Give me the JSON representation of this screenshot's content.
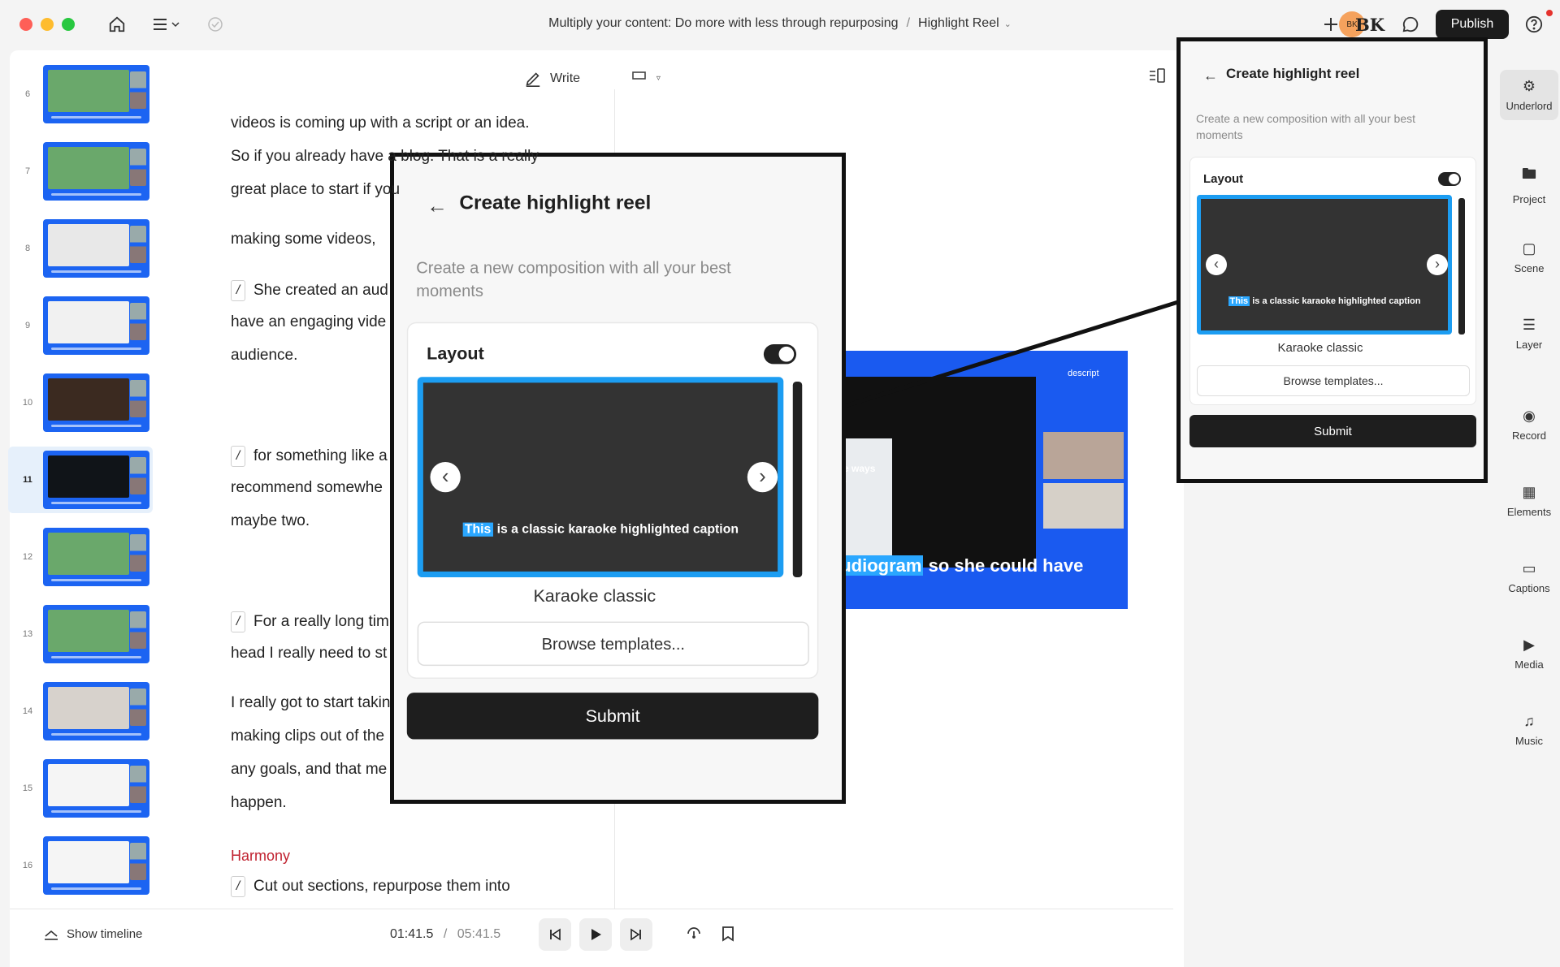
{
  "app": {
    "breadcrumb_project": "Multiply your content: Do more with less through repurposing",
    "breadcrumb_sep": "/",
    "breadcrumb_comp": "Highlight Reel",
    "avatar_initials": "BK",
    "avatar_small": "BK",
    "publish_label": "Publish"
  },
  "editor": {
    "write_label": "Write",
    "scenes": [
      {
        "num": "6"
      },
      {
        "num": "7"
      },
      {
        "num": "8"
      },
      {
        "num": "9"
      },
      {
        "num": "10"
      },
      {
        "num": "11"
      },
      {
        "num": "12"
      },
      {
        "num": "13"
      },
      {
        "num": "14"
      },
      {
        "num": "15"
      },
      {
        "num": "16"
      }
    ],
    "script_lines": [
      "videos is coming up with a script or an idea.",
      "So if you already have a blog. That is a really",
      "great place to start if you",
      "making some videos,",
      "She created an aud",
      "have an engaging vide",
      "audience.",
      "for something like a",
      "recommend somewhe",
      "maybe two.",
      "For a really long tim",
      "head I really need to st",
      "I really got to start takin",
      "making clips out of the",
      "any goals, and that me",
      "happen.",
      "Cut out sections, repurpose them into"
    ],
    "speaker": "Harmony"
  },
  "preview": {
    "caption_highlight": "audiogram",
    "caption_rest": "so she could have",
    "logo": "descript",
    "side_text": "five ways hts"
  },
  "playback": {
    "show_timeline": "Show timeline",
    "current_time": "01:41.5",
    "separator": "/",
    "total_time": "05:41.5"
  },
  "highlight_panel": {
    "title": "Create highlight reel",
    "description": "Create a new composition with all your best moments",
    "layout_label": "Layout",
    "layout_toggle_on": true,
    "caption_highlight": "This",
    "caption_rest": " is a classic karaoke highlighted caption",
    "template_name": "Karaoke classic",
    "browse_label": "Browse templates...",
    "submit_label": "Submit"
  },
  "rail": {
    "items": [
      {
        "label": "Underlord",
        "icon": "robot-icon"
      },
      {
        "label": "Project",
        "icon": "folder-icon"
      },
      {
        "label": "Scene",
        "icon": "scene-icon"
      },
      {
        "label": "Layer",
        "icon": "layers-icon"
      },
      {
        "label": "Record",
        "icon": "record-icon"
      },
      {
        "label": "Elements",
        "icon": "elements-icon"
      },
      {
        "label": "Captions",
        "icon": "captions-icon"
      },
      {
        "label": "Media",
        "icon": "media-icon"
      },
      {
        "label": "Music",
        "icon": "music-icon"
      }
    ]
  },
  "colors": {
    "accent_blue": "#1c64f2",
    "caption_highlight": "#2aa7ff",
    "speaker_red": "#c0212f",
    "publish_bg": "#1c1c1c"
  }
}
